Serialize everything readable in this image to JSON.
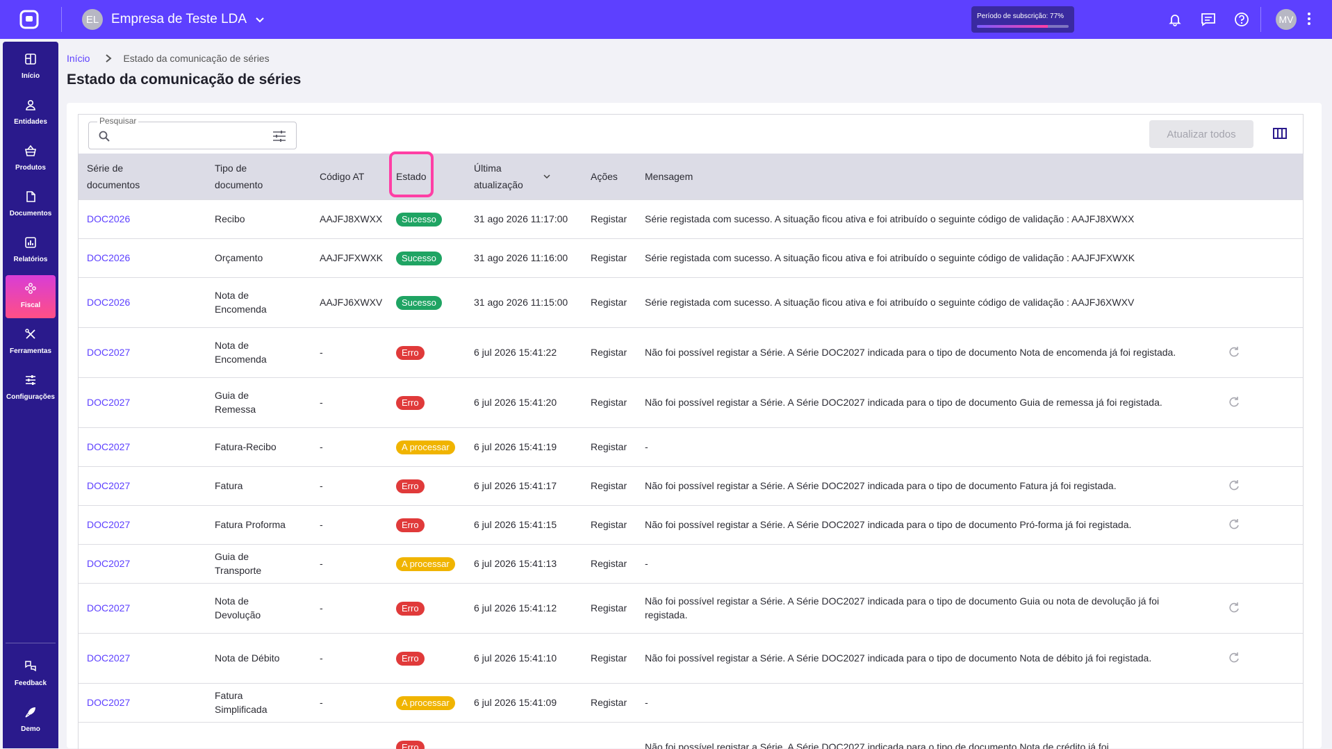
{
  "topbar": {
    "company_initials": "EL",
    "company_name": "Empresa de Teste LDA",
    "subscription_label": "Período de subscrição: 77%",
    "subscription_progress": 0.77,
    "user_initials": "MV",
    "brand_color": "#5d40ff"
  },
  "sidebar": {
    "items": [
      {
        "label": "Início",
        "icon": "home-icon"
      },
      {
        "label": "Entidades",
        "icon": "user-icon"
      },
      {
        "label": "Produtos",
        "icon": "basket-icon"
      },
      {
        "label": "Documentos",
        "icon": "document-icon"
      },
      {
        "label": "Relatórios",
        "icon": "chart-icon"
      },
      {
        "label": "Fiscal",
        "icon": "fiscal-icon",
        "active": true
      },
      {
        "label": "Ferramentas",
        "icon": "tools-icon"
      },
      {
        "label": "Configurações",
        "icon": "sliders-icon"
      }
    ],
    "bottom_items": [
      {
        "label": "Feedback",
        "icon": "feedback-icon"
      },
      {
        "label": "Demo",
        "icon": "rocket-icon"
      }
    ]
  },
  "breadcrumb": {
    "home": "Início",
    "current": "Estado da comunicação de séries"
  },
  "page_title": "Estado da comunicação de séries",
  "toolbar": {
    "search_label": "Pesquisar",
    "search_value": "",
    "update_all_label": "Atualizar todos"
  },
  "table": {
    "headers": {
      "serie": "Série de documentos",
      "tipo": "Tipo de documento",
      "codigo": "Código AT",
      "estado": "Estado",
      "ultima": "Última atualização",
      "acoes": "Ações",
      "mensagem": "Mensagem"
    },
    "status_colors": {
      "Sucesso": "#1fa463",
      "Erro": "#e03a3a",
      "A processar": "#f0b400"
    },
    "rows": [
      {
        "serie": "DOC2026",
        "tipo": "Recibo",
        "codigo": "AAJFJ8XWXX",
        "estado": "Sucesso",
        "ultima": "31 ago 2026 11:17:00",
        "acao": "Registar",
        "mensagem": "Série registada com sucesso. A situação ficou ativa e foi atribuído o seguinte código de validação : AAJFJ8XWXX",
        "retry": false
      },
      {
        "serie": "DOC2026",
        "tipo": "Orçamento",
        "codigo": "AAJFJFXWXK",
        "estado": "Sucesso",
        "ultima": "31 ago 2026 11:16:00",
        "acao": "Registar",
        "mensagem": "Série registada com sucesso. A situação ficou ativa e foi atribuído o seguinte código de validação : AAJFJFXWXK",
        "retry": false
      },
      {
        "serie": "DOC2026",
        "tipo": "Nota de Encomenda",
        "codigo": "AAJFJ6XWXV",
        "estado": "Sucesso",
        "ultima": "31 ago 2026 11:15:00",
        "acao": "Registar",
        "mensagem": "Série registada com sucesso. A situação ficou ativa e foi atribuído o seguinte código de validação : AAJFJ6XWXV",
        "retry": false
      },
      {
        "serie": "DOC2027",
        "tipo": "Nota de Encomenda",
        "codigo": "-",
        "estado": "Erro",
        "ultima": "6 jul 2026 15:41:22",
        "acao": "Registar",
        "mensagem": "Não foi possível registar a Série. A Série DOC2027 indicada para o tipo de documento Nota de encomenda já foi registada.",
        "retry": true
      },
      {
        "serie": "DOC2027",
        "tipo": "Guia de Remessa",
        "codigo": "-",
        "estado": "Erro",
        "ultima": "6 jul 2026 15:41:20",
        "acao": "Registar",
        "mensagem": "Não foi possível registar a Série. A Série DOC2027 indicada para o tipo de documento Guia de remessa já foi registada.",
        "retry": true
      },
      {
        "serie": "DOC2027",
        "tipo": "Fatura-Recibo",
        "codigo": "-",
        "estado": "A processar",
        "ultima": "6 jul 2026 15:41:19",
        "acao": "Registar",
        "mensagem": "-",
        "retry": false
      },
      {
        "serie": "DOC2027",
        "tipo": "Fatura",
        "codigo": "-",
        "estado": "Erro",
        "ultima": "6 jul 2026 15:41:17",
        "acao": "Registar",
        "mensagem": "Não foi possível registar a Série. A Série DOC2027 indicada para o tipo de documento Fatura já foi registada.",
        "retry": true
      },
      {
        "serie": "DOC2027",
        "tipo": "Fatura Proforma",
        "codigo": "-",
        "estado": "Erro",
        "ultima": "6 jul 2026 15:41:15",
        "acao": "Registar",
        "mensagem": "Não foi possível registar a Série. A Série DOC2027 indicada para o tipo de documento Pró-forma já foi registada.",
        "retry": true
      },
      {
        "serie": "DOC2027",
        "tipo": "Guia de Transporte",
        "codigo": "-",
        "estado": "A processar",
        "ultima": "6 jul 2026 15:41:13",
        "acao": "Registar",
        "mensagem": "-",
        "retry": false
      },
      {
        "serie": "DOC2027",
        "tipo": "Nota de Devolução",
        "codigo": "-",
        "estado": "Erro",
        "ultima": "6 jul 2026 15:41:12",
        "acao": "Registar",
        "mensagem": "Não foi possível registar a Série. A Série DOC2027 indicada para o tipo de documento Guia ou nota de devolução já foi registada.",
        "retry": true
      },
      {
        "serie": "DOC2027",
        "tipo": "Nota de Débito",
        "codigo": "-",
        "estado": "Erro",
        "ultima": "6 jul 2026 15:41:10",
        "acao": "Registar",
        "mensagem": "Não foi possível registar a Série. A Série DOC2027 indicada para o tipo de documento Nota de débito já foi registada.",
        "retry": true
      },
      {
        "serie": "DOC2027",
        "tipo": "Fatura Simplificada",
        "codigo": "-",
        "estado": "A processar",
        "ultima": "6 jul 2026 15:41:09",
        "acao": "Registar",
        "mensagem": "-",
        "retry": false
      },
      {
        "serie": "",
        "tipo": "",
        "codigo": "",
        "estado": "Erro",
        "ultima": "",
        "acao": "",
        "mensagem": "Não foi possível registar a Série. A Série DOC2027 indicada para o tipo de documento Nota de crédito já foi",
        "retry": false
      }
    ]
  }
}
